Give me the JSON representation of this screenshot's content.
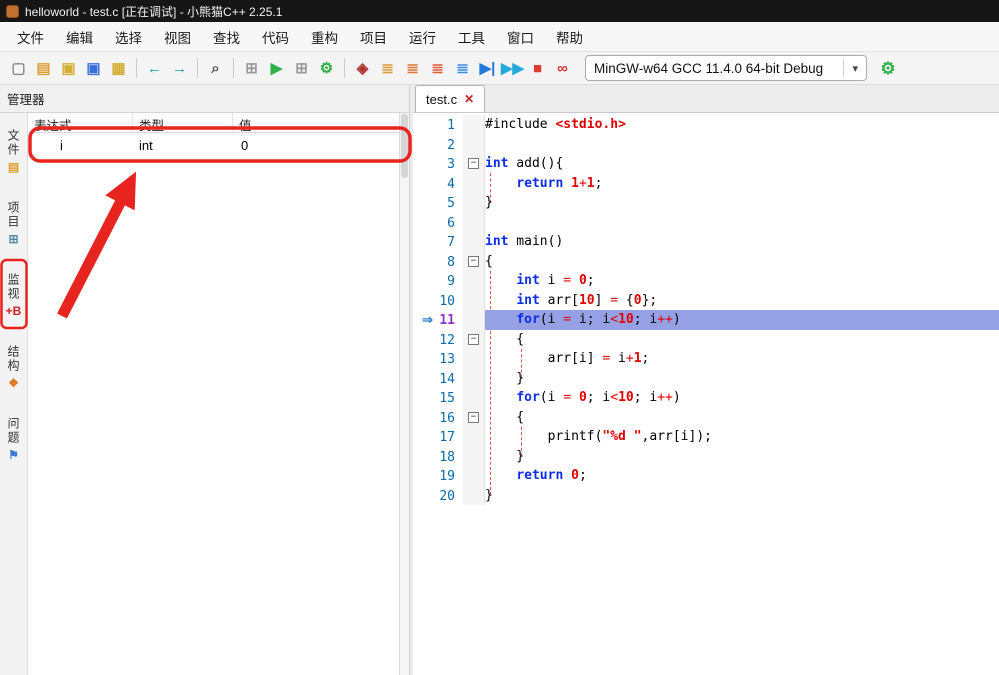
{
  "window": {
    "title": "helloworld - test.c [正在调试] - 小熊猫C++ 2.25.1"
  },
  "menu_bar": {
    "items": [
      "文件",
      "编辑",
      "选择",
      "视图",
      "查找",
      "代码",
      "重构",
      "项目",
      "运行",
      "工具",
      "窗口",
      "帮助"
    ]
  },
  "toolbar": {
    "items": [
      {
        "name": "new-file",
        "glyph": "▢",
        "color": "#8a8a8a"
      },
      {
        "name": "open-file",
        "glyph": "▤",
        "color": "#e0a030"
      },
      {
        "name": "save",
        "glyph": "▣",
        "color": "#d4af37"
      },
      {
        "name": "save-as",
        "glyph": "▣",
        "color": "#3a6fd8"
      },
      {
        "name": "save-all",
        "glyph": "▦",
        "color": "#d4af37"
      },
      {
        "sep": true
      },
      {
        "name": "back",
        "glyph": "←",
        "color": "#1a9e9e"
      },
      {
        "name": "forward",
        "glyph": "→",
        "color": "#1a9e9e"
      },
      {
        "sep": true
      },
      {
        "name": "find-in-files",
        "glyph": "⌕",
        "color": "#555555"
      },
      {
        "sep": true
      },
      {
        "name": "compile",
        "glyph": "⊞",
        "color": "#9a9a9a"
      },
      {
        "name": "run",
        "glyph": "▶",
        "color": "#2fae49"
      },
      {
        "name": "compile-and-run",
        "glyph": "⊞",
        "color": "#9a9a9a"
      },
      {
        "name": "rebuild",
        "glyph": "⚙",
        "color": "#2fae49"
      },
      {
        "sep": true
      },
      {
        "name": "debug",
        "glyph": "◈",
        "color": "#b03030"
      },
      {
        "name": "step-over",
        "glyph": "≣",
        "color": "#e0983a"
      },
      {
        "name": "step-into",
        "glyph": "≣",
        "color": "#e0763a"
      },
      {
        "name": "step-out",
        "glyph": "≣",
        "color": "#e0583a"
      },
      {
        "name": "run-to-cursor",
        "glyph": "≣",
        "color": "#3a8ee0"
      },
      {
        "name": "step-over-line",
        "glyph": "▶|",
        "color": "#2277dd"
      },
      {
        "name": "continue",
        "glyph": "▶▶",
        "color": "#22aadd"
      },
      {
        "name": "stop-execution",
        "glyph": "■",
        "color": "#e03c31"
      },
      {
        "name": "cpu-info",
        "glyph": "∞",
        "color": "#d03030"
      }
    ],
    "compiler": {
      "label": "MinGW-w64 GCC 11.4.0 64-bit Debug",
      "dropdown_glyph": "▾"
    },
    "settings": {
      "glyph": "⚙"
    }
  },
  "manager": {
    "title": "管理器",
    "watch": {
      "columns": [
        "表达式",
        "类型",
        "值"
      ],
      "rows": [
        {
          "expression": "i",
          "type": "int",
          "value": "0"
        }
      ]
    }
  },
  "sidebar": {
    "tabs": [
      {
        "name": "files",
        "label": "文件",
        "glyph": "▤",
        "color": "#e0a030"
      },
      {
        "name": "project",
        "label": "项目",
        "glyph": "⊞",
        "color": "#5588aa"
      },
      {
        "name": "watch",
        "label": "监视",
        "glyph": "+B",
        "color": "#cc2222",
        "active": true
      },
      {
        "name": "structure",
        "label": "结构",
        "glyph": "❖",
        "color": "#e07820"
      },
      {
        "name": "issues",
        "label": "问题",
        "glyph": "⚑",
        "color": "#3a7bd5"
      }
    ]
  },
  "editor": {
    "tab": {
      "label": "test.c",
      "close_glyph": "✕"
    },
    "current_line": 11,
    "gutter_arrow": "⇒",
    "lines": [
      {
        "n": 1,
        "tokens": [
          {
            "t": "#include ",
            "c": "pl"
          },
          {
            "t": "<stdio.h>",
            "c": "inc"
          }
        ]
      },
      {
        "n": 2,
        "tokens": []
      },
      {
        "n": 3,
        "fold": true,
        "tokens": [
          {
            "t": "int",
            "c": "kw"
          },
          {
            "t": " add(){",
            "c": "pl"
          }
        ]
      },
      {
        "n": 4,
        "tokens": [
          {
            "t": "    ",
            "c": "pl"
          },
          {
            "t": "return",
            "c": "kw"
          },
          {
            "t": " ",
            "c": "pl"
          },
          {
            "t": "1",
            "c": "num"
          },
          {
            "t": "+",
            "c": "op"
          },
          {
            "t": "1",
            "c": "num"
          },
          {
            "t": ";",
            "c": "pl"
          }
        ]
      },
      {
        "n": 5,
        "tokens": [
          {
            "t": "}",
            "c": "pl"
          }
        ]
      },
      {
        "n": 6,
        "tokens": []
      },
      {
        "n": 7,
        "tokens": [
          {
            "t": "int",
            "c": "kw"
          },
          {
            "t": " main()",
            "c": "pl"
          }
        ]
      },
      {
        "n": 8,
        "fold": true,
        "tokens": [
          {
            "t": "{",
            "c": "pl"
          }
        ]
      },
      {
        "n": 9,
        "tokens": [
          {
            "t": "    ",
            "c": "pl"
          },
          {
            "t": "int",
            "c": "kw"
          },
          {
            "t": " i ",
            "c": "pl"
          },
          {
            "t": "=",
            "c": "op"
          },
          {
            "t": " ",
            "c": "pl"
          },
          {
            "t": "0",
            "c": "num"
          },
          {
            "t": ";",
            "c": "pl"
          }
        ]
      },
      {
        "n": 10,
        "tokens": [
          {
            "t": "    ",
            "c": "pl"
          },
          {
            "t": "int",
            "c": "kw"
          },
          {
            "t": " arr[",
            "c": "pl"
          },
          {
            "t": "10",
            "c": "num"
          },
          {
            "t": "] ",
            "c": "pl"
          },
          {
            "t": "=",
            "c": "op"
          },
          {
            "t": " {",
            "c": "pl"
          },
          {
            "t": "0",
            "c": "num"
          },
          {
            "t": "};",
            "c": "pl"
          }
        ]
      },
      {
        "n": 11,
        "tokens": [
          {
            "t": "    ",
            "c": "pl"
          },
          {
            "t": "for",
            "c": "kw"
          },
          {
            "t": "(i ",
            "c": "pl"
          },
          {
            "t": "=",
            "c": "op"
          },
          {
            "t": " i; i",
            "c": "pl"
          },
          {
            "t": "<",
            "c": "op"
          },
          {
            "t": "10",
            "c": "num"
          },
          {
            "t": "; i",
            "c": "pl"
          },
          {
            "t": "++",
            "c": "op"
          },
          {
            "t": ")",
            "c": "pl"
          }
        ]
      },
      {
        "n": 12,
        "fold": true,
        "tokens": [
          {
            "t": "    {",
            "c": "pl"
          }
        ]
      },
      {
        "n": 13,
        "tokens": [
          {
            "t": "        arr[i] ",
            "c": "pl"
          },
          {
            "t": "=",
            "c": "op"
          },
          {
            "t": " i",
            "c": "pl"
          },
          {
            "t": "+",
            "c": "op"
          },
          {
            "t": "1",
            "c": "num"
          },
          {
            "t": ";",
            "c": "pl"
          }
        ]
      },
      {
        "n": 14,
        "tokens": [
          {
            "t": "    }",
            "c": "pl"
          }
        ]
      },
      {
        "n": 15,
        "tokens": [
          {
            "t": "    ",
            "c": "pl"
          },
          {
            "t": "for",
            "c": "kw"
          },
          {
            "t": "(i ",
            "c": "pl"
          },
          {
            "t": "=",
            "c": "op"
          },
          {
            "t": " ",
            "c": "pl"
          },
          {
            "t": "0",
            "c": "num"
          },
          {
            "t": "; i",
            "c": "pl"
          },
          {
            "t": "<",
            "c": "op"
          },
          {
            "t": "10",
            "c": "num"
          },
          {
            "t": "; i",
            "c": "pl"
          },
          {
            "t": "++",
            "c": "op"
          },
          {
            "t": ")",
            "c": "pl"
          }
        ]
      },
      {
        "n": 16,
        "fold": true,
        "tokens": [
          {
            "t": "    {",
            "c": "pl"
          }
        ]
      },
      {
        "n": 17,
        "tokens": [
          {
            "t": "        printf(",
            "c": "pl"
          },
          {
            "t": "\"%d \"",
            "c": "str"
          },
          {
            "t": ",arr[i]);",
            "c": "pl"
          }
        ]
      },
      {
        "n": 18,
        "tokens": [
          {
            "t": "    }",
            "c": "pl"
          }
        ]
      },
      {
        "n": 19,
        "tokens": [
          {
            "t": "    ",
            "c": "pl"
          },
          {
            "t": "return",
            "c": "kw"
          },
          {
            "t": " ",
            "c": "pl"
          },
          {
            "t": "0",
            "c": "num"
          },
          {
            "t": ";",
            "c": "pl"
          }
        ]
      },
      {
        "n": 20,
        "tokens": [
          {
            "t": "}",
            "c": "pl"
          }
        ]
      }
    ]
  },
  "colors": {
    "annotation_red": "#e8241f",
    "current_line_bg": "#96a0e4",
    "keyword": "#0b2ee8",
    "number": "#e00000",
    "string": "#e00000",
    "line_number": "#0a6aaa",
    "current_line_number": "#8833cc",
    "accent_green": "#2fae49"
  }
}
